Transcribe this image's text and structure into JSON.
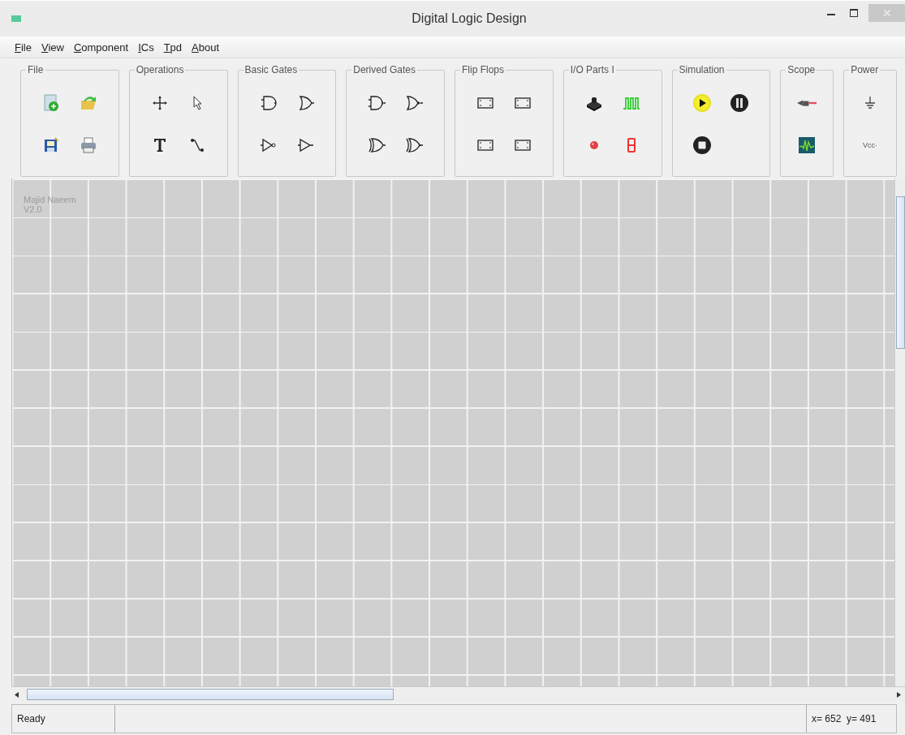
{
  "window": {
    "title": "Digital Logic Design"
  },
  "menu": [
    "File",
    "View",
    "Component",
    "ICs",
    "Tpd",
    "About"
  ],
  "toolbar": [
    {
      "title": "File",
      "tools": [
        {
          "kind": "new"
        },
        {
          "kind": "open"
        },
        {
          "kind": "save"
        },
        {
          "kind": "print"
        }
      ]
    },
    {
      "title": "Operations",
      "tools": [
        {
          "kind": "move"
        },
        {
          "kind": "select"
        },
        {
          "kind": "text"
        },
        {
          "kind": "wire"
        }
      ]
    },
    {
      "title": "Basic Gates",
      "tools": [
        {
          "kind": "and"
        },
        {
          "kind": "or"
        },
        {
          "kind": "not"
        },
        {
          "kind": "buffer"
        }
      ]
    },
    {
      "title": "Derived Gates",
      "tools": [
        {
          "kind": "nand"
        },
        {
          "kind": "nor"
        },
        {
          "kind": "xor"
        },
        {
          "kind": "xnor"
        }
      ]
    },
    {
      "title": "Flip Flops",
      "tools": [
        {
          "kind": "flipflop"
        },
        {
          "kind": "flipflop"
        },
        {
          "kind": "flipflop"
        },
        {
          "kind": "flipflop"
        }
      ]
    },
    {
      "title": "I/O Parts I",
      "tools": [
        {
          "kind": "switch"
        },
        {
          "kind": "clock"
        },
        {
          "kind": "led"
        },
        {
          "kind": "segment"
        }
      ]
    },
    {
      "title": "Simulation",
      "tools": [
        {
          "kind": "play"
        },
        {
          "kind": "pause"
        },
        {
          "kind": "stop"
        }
      ]
    },
    {
      "title": "Scope",
      "tools": [
        {
          "kind": "probe"
        },
        {
          "kind": "scope"
        }
      ]
    },
    {
      "title": "Power",
      "tools": [
        {
          "kind": "ground"
        },
        {
          "kind": "vcc",
          "label": "Vcc·"
        }
      ]
    }
  ],
  "canvas": {
    "watermark": [
      "Majid Naeem",
      "V2.0"
    ]
  },
  "status_bar": {
    "message": "Ready",
    "coordinates": "x= 652  y= 491"
  }
}
